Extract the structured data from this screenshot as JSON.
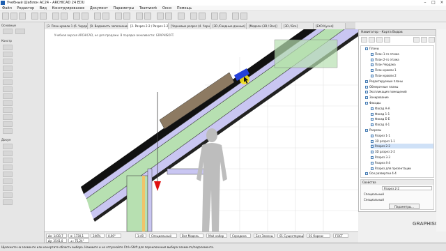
{
  "window": {
    "title": "Учебный Шаблон АС24 - ARCHICAD 24 EDU",
    "min_icon": "minimize-icon",
    "max_icon": "maximize-icon",
    "close_icon": "close-icon"
  },
  "menu": [
    "Файл",
    "Редактор",
    "Вид",
    "Конструирование",
    "Документ",
    "Параметры",
    "Teamwork",
    "Окно",
    "Помощь"
  ],
  "tabs": [
    "[3. План кровли 1 (6. Чердак)",
    "[9. Ведомость заполнения п.",
    "[2. Разрез 2-2 / Разрез 2-2]",
    "[Черновые разрез (4. Черно",
    "[3D /Сводные данные]",
    "[Модели (3D / Все)]",
    "[3D / Все]",
    "[ЕХО Кухня]"
  ],
  "canvas": {
    "edu_watermark": "Учебная версия ARCHICAD, не для продажи. В порядке вежливости: GRAPHISOFT.",
    "branding": "GRAPHISOFT"
  },
  "toolbox": {
    "sections": [
      "Основные",
      "Констр",
      "Докум"
    ]
  },
  "navigator": {
    "title": "Навигатор - Карта Видов",
    "tree": [
      {
        "label": "Планы",
        "level": 1
      },
      {
        "label": "План 1-го этажа",
        "level": 2
      },
      {
        "label": "План 2-го этажа",
        "level": 2
      },
      {
        "label": "План Чердака",
        "level": 2
      },
      {
        "label": "План кровли 1",
        "level": 2
      },
      {
        "label": "План кровли 2",
        "level": 2
      },
      {
        "label": "Редактируемые планы",
        "level": 1
      },
      {
        "label": "Обмерочные планы",
        "level": 1
      },
      {
        "label": "Экспликация помещений",
        "level": 1
      },
      {
        "label": "Зонирование",
        "level": 1
      },
      {
        "label": "Фасады",
        "level": 1
      },
      {
        "label": "Фасад А-А",
        "level": 2
      },
      {
        "label": "Фасад 1-1",
        "level": 2
      },
      {
        "label": "Фасад Б-Б",
        "level": 2
      },
      {
        "label": "Фасад 4-1",
        "level": 2
      },
      {
        "label": "Разрезы",
        "level": 1
      },
      {
        "label": "Разрез 1-1",
        "level": 2
      },
      {
        "label": "3D разрез 1-1",
        "level": 2
      },
      {
        "label": "Разрез 2-2",
        "level": 2,
        "selected": true
      },
      {
        "label": "3D разрез 2-2",
        "level": 2
      },
      {
        "label": "Разрез 3-3",
        "level": 2
      },
      {
        "label": "Разрез 4-4",
        "level": 2
      },
      {
        "label": "Разрез для презентации",
        "level": 2
      },
      {
        "label": "Оси развертки 4-4",
        "level": 1
      }
    ],
    "props_title": "Свойства",
    "props_value": "Разрез 2-2",
    "props_row1": "Специальный",
    "props_row2": "Специальный",
    "props_button": "Параметры..."
  },
  "infobox": {
    "coords_a": "Δx: 1430,7",
    "coords_b": "Δy: 3541,0",
    "len_a": "a: 1730,1",
    "len_b": "∠: 75,24°",
    "zoom": "246%",
    "angle": "0,00°",
    "scale": "1:40",
    "layer": "Специальный",
    "model": "Вся Модель",
    "pen": "Мой набор",
    "structure": "Середина",
    "mvo": "Без Замены",
    "renov": "01 Существующ",
    "gdl": "01 Каркас",
    "gost": "ГОСТ"
  },
  "status": "Щелкните на элементе или начертите область выбора. Нажмите и не отпускайте Ctrl+Shift для переключения выбора элемента/подэлемента.",
  "colors": {
    "insulation": "#b7e0b1",
    "membrane": "#8d7a62",
    "arrow": "#e01010",
    "highlight": "#f5e21a",
    "selection_blue": "#2440d8"
  }
}
